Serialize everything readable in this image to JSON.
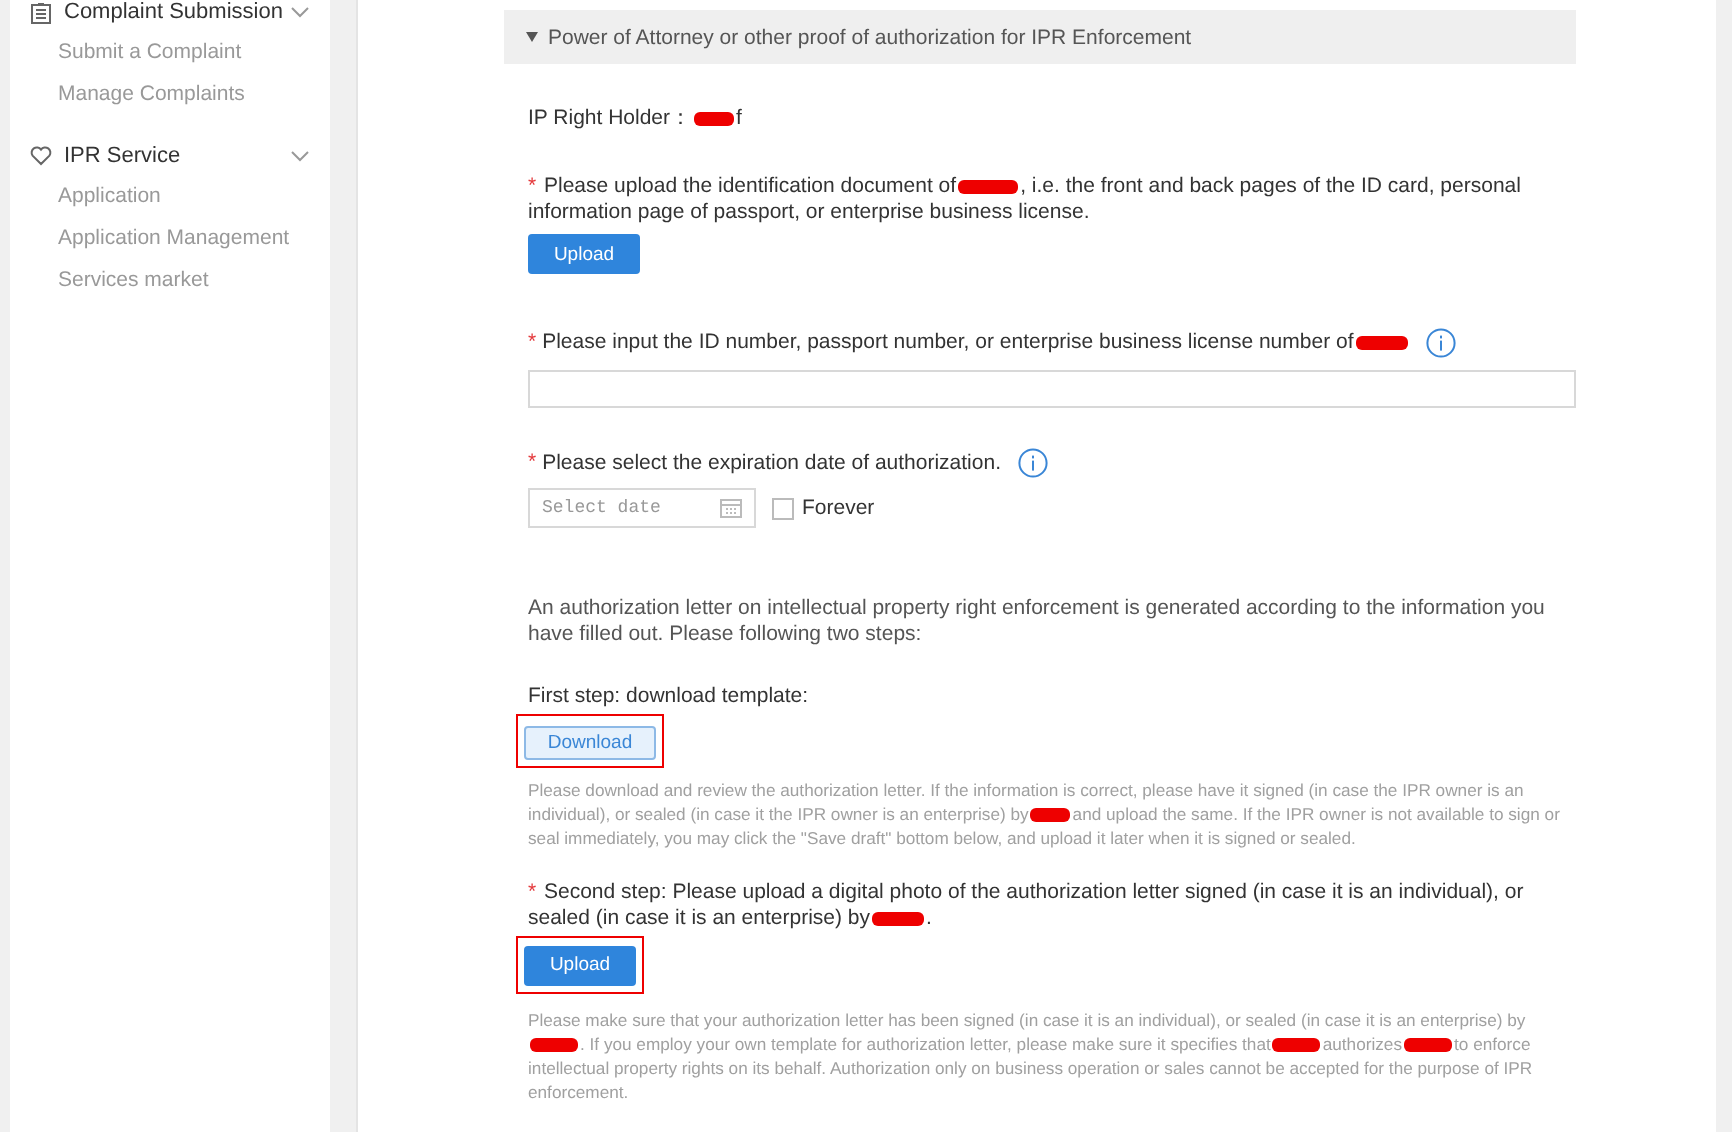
{
  "sidebar": {
    "groups": [
      {
        "title": "Complaint Submission",
        "expanded": true,
        "items": [
          "Submit a Complaint",
          "Manage Complaints"
        ]
      },
      {
        "title": "IPR Service",
        "expanded": true,
        "items": [
          "Application",
          "Application Management",
          "Services market"
        ]
      }
    ]
  },
  "section": {
    "title": "Power of Attorney or other proof of authorization for IPR Enforcement",
    "expanded": true
  },
  "holder": [
    {
      "kind": "text",
      "text": "IP Right Holder："
    },
    {
      "kind": "redaction"
    },
    {
      "kind": "text",
      "text": "f"
    }
  ],
  "id_document": {
    "required_mark": "*",
    "label": [
      {
        "kind": "text",
        "text": "Please upload the identification document of"
      },
      {
        "kind": "redaction"
      },
      {
        "kind": "text",
        "text": ", i.e. the front and back pages of the ID card, personal information page of passport, or enterprise business license."
      }
    ],
    "button": "Upload"
  },
  "id_number": {
    "required_mark": "*",
    "label": [
      {
        "kind": "text",
        "text": "Please input the ID number, passport number, or enterprise business license number of"
      },
      {
        "kind": "redaction"
      }
    ]
  },
  "expiration": {
    "required_mark": "*",
    "label": "Please select the expiration date of authorization.",
    "placeholder": "Select date",
    "forever_label": "Forever",
    "forever_checked": false
  },
  "intro": "An authorization letter on intellectual property right enforcement is generated according to the information you have filled out. Please following two steps:",
  "step1": {
    "label": "First step: download template:",
    "button": "Download",
    "highlighted": true,
    "note": [
      {
        "kind": "text",
        "text": "Please download and review the authorization letter. If the information is correct, please have it signed (in case the IPR owner is an individual), or sealed (in case it the IPR owner is an enterprise) by"
      },
      {
        "kind": "redaction"
      },
      {
        "kind": "text",
        "text": "and upload the same. If the IPR owner is not available to sign or seal immediately, you may click the \"Save draft\" bottom below, and upload it later when it is signed or sealed."
      }
    ]
  },
  "step2": {
    "required_mark": "*",
    "label": [
      {
        "kind": "text",
        "text": "Second step: Please upload a digital photo of the authorization letter signed (in case it is an individual), or sealed (in case it is an enterprise) by"
      },
      {
        "kind": "redaction"
      },
      {
        "kind": "text",
        "text": "."
      }
    ],
    "button": "Upload",
    "highlighted": true,
    "note": [
      {
        "kind": "text",
        "text": "Please make sure that your authorization letter has been signed (in case it is an individual), or sealed (in case it is an enterprise) by"
      },
      {
        "kind": "redaction"
      },
      {
        "kind": "text",
        "text": ". If you employ your own template for authorization letter, please make sure it specifies that"
      },
      {
        "kind": "redaction"
      },
      {
        "kind": "text",
        "text": "authorizes"
      },
      {
        "kind": "redaction"
      },
      {
        "kind": "text",
        "text": "to enforce intellectual property rights on its behalf. Authorization only on business operation or sales cannot be accepted for the purpose of IPR enforcement."
      }
    ]
  }
}
